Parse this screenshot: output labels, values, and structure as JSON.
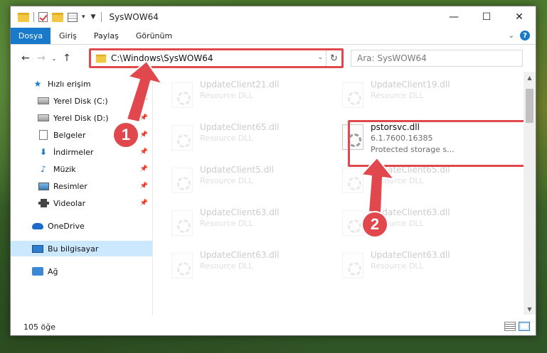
{
  "window": {
    "title": "SysWOW64",
    "controls": {
      "minimize": "—",
      "maximize": "☐",
      "close": "✕"
    }
  },
  "ribbon": {
    "tabs": [
      "Dosya",
      "Giriş",
      "Paylaş",
      "Görünüm"
    ],
    "help": "?"
  },
  "navigation": {
    "back": "←",
    "forward": "→",
    "recent": "⌄",
    "up": "↑",
    "address": "C:\\Windows\\SysWOW64",
    "address_dropdown": "⌄",
    "refresh": "↻",
    "search_placeholder": "Ara: SysWOW64"
  },
  "sidebar": {
    "items": [
      {
        "label": "Hızlı erişim",
        "icon": "star-icon",
        "pinned": false
      },
      {
        "label": "Yerel Disk (C:)",
        "icon": "disk-icon",
        "pinned": true
      },
      {
        "label": "Yerel Disk (D:)",
        "icon": "disk-icon",
        "pinned": true
      },
      {
        "label": "Belgeler",
        "icon": "document-icon",
        "pinned": true
      },
      {
        "label": "İndirmeler",
        "icon": "download-icon",
        "pinned": true
      },
      {
        "label": "Müzik",
        "icon": "music-icon",
        "pinned": true
      },
      {
        "label": "Resimler",
        "icon": "pictures-icon",
        "pinned": true
      },
      {
        "label": "Videolar",
        "icon": "videos-icon",
        "pinned": true
      },
      {
        "label": "OneDrive",
        "icon": "cloud-icon",
        "pinned": false
      },
      {
        "label": "Bu bilgisayar",
        "icon": "computer-icon",
        "pinned": false,
        "selected": true
      },
      {
        "label": "Ağ",
        "icon": "network-icon",
        "pinned": false
      }
    ]
  },
  "files": [
    {
      "name": "UpdateClient21.dll",
      "desc": "Resource DLL",
      "faded": true
    },
    {
      "name": "UpdateClient19.dll",
      "desc": "Resource DLL",
      "faded": true
    },
    {
      "name": "UpdateClient65.dll",
      "desc": "Resource DLL",
      "faded": true
    },
    {
      "name": "pstorsvc.dll",
      "version": "6.1.7600.16385",
      "desc": "Protected storage s...",
      "faded": false,
      "highlighted": true
    },
    {
      "name": "UpdateClient5.dll",
      "desc": "Resource DLL",
      "faded": true
    },
    {
      "name": "UpdateClient65.dll",
      "desc": "Resource DLL",
      "faded": true
    },
    {
      "name": "UpdateClient63.dll",
      "desc": "Resource DLL",
      "faded": true
    },
    {
      "name": "UpdateClient63.dll",
      "desc": "Resource DLL",
      "faded": true
    },
    {
      "name": "UpdateClient63.dll",
      "desc": "Resource DLL",
      "faded": true
    },
    {
      "name": "UpdateClient63.dll",
      "desc": "Resource DLL",
      "faded": true
    }
  ],
  "status": {
    "item_count": "105 öğe"
  },
  "annotations": {
    "marker_1": "1",
    "marker_2": "2",
    "color": "#e0484d"
  }
}
